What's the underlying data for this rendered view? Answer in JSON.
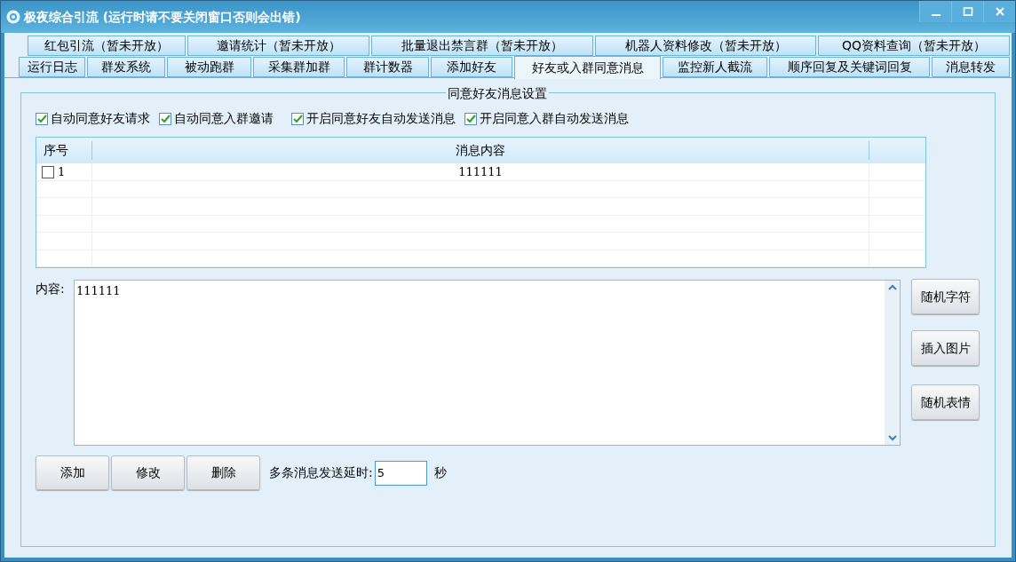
{
  "window": {
    "title": "极夜综合引流 (运行时请不要关闭窗口否则会出错)"
  },
  "tab_rows": [
    [
      {
        "label": "红包引流（暂未开放）",
        "selected": false
      },
      {
        "label": "邀请统计（暂未开放）",
        "selected": false
      },
      {
        "label": "批量退出禁言群（暂未开放）",
        "selected": false
      },
      {
        "label": "机器人资料修改（暂未开放）",
        "selected": false
      },
      {
        "label": "QQ资料查询（暂未开放）",
        "selected": false
      }
    ],
    [
      {
        "label": "运行日志",
        "selected": false
      },
      {
        "label": "群发系统",
        "selected": false
      },
      {
        "label": "被动跑群",
        "selected": false
      },
      {
        "label": "采集群加群",
        "selected": false
      },
      {
        "label": "群计数器",
        "selected": false
      },
      {
        "label": "添加好友",
        "selected": false
      },
      {
        "label": "好友或入群同意消息",
        "selected": true
      },
      {
        "label": "监控新人截流",
        "selected": false
      },
      {
        "label": "顺序回复及关键词回复",
        "selected": false
      },
      {
        "label": "消息转发",
        "selected": false
      }
    ]
  ],
  "group": {
    "title": "同意好友消息设置",
    "options": [
      {
        "label": "自动同意好友请求",
        "checked": true
      },
      {
        "label": "自动同意入群邀请",
        "checked": true
      },
      {
        "label": "开启同意好友自动发送消息",
        "checked": true
      },
      {
        "label": "开启同意入群自动发送消息",
        "checked": true
      }
    ],
    "table": {
      "columns": [
        "序号",
        "消息内容"
      ],
      "rows": [
        {
          "index": "1",
          "content": "111111",
          "checked": false
        }
      ]
    },
    "content_label": "内容:",
    "content_value": "111111",
    "side_buttons": [
      "随机字符",
      "插入图片",
      "随机表情"
    ],
    "buttons": [
      "添加",
      "修改",
      "删除"
    ],
    "delay_label": "多条消息发送延时:",
    "delay_value": "5",
    "delay_unit": "秒"
  }
}
